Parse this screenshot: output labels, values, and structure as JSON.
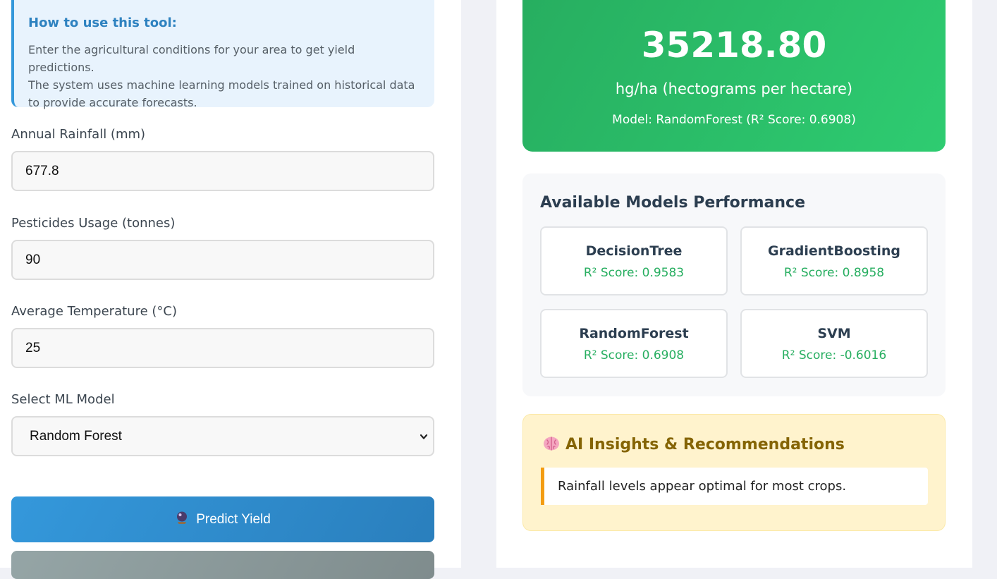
{
  "help": {
    "title": "How to use this tool:",
    "line1": "Enter the agricultural conditions for your area to get yield predictions.",
    "line2": "The system uses machine learning models trained on historical data",
    "line3": "to provide accurate forecasts."
  },
  "form": {
    "rainfall_label": "Annual Rainfall (mm)",
    "rainfall_value": "677.8",
    "pesticides_label": "Pesticides Usage (tonnes)",
    "pesticides_value": "90",
    "temperature_label": "Average Temperature (°C)",
    "temperature_value": "25",
    "model_label": "Select ML Model",
    "model_selected": "Random Forest",
    "predict_button": "Predict Yield",
    "predict_icon": "crystal-ball-icon"
  },
  "result": {
    "value": "35218.80",
    "unit": "hg/ha (hectograms per hectare)",
    "model_info": "Model: RandomForest (R² Score: 0.6908)"
  },
  "models": {
    "title": "Available Models Performance",
    "items": [
      {
        "name": "DecisionTree",
        "score": "R² Score: 0.9583"
      },
      {
        "name": "GradientBoosting",
        "score": "R² Score: 0.8958"
      },
      {
        "name": "RandomForest",
        "score": "R² Score: 0.6908"
      },
      {
        "name": "SVM",
        "score": "R² Score: -0.6016"
      }
    ]
  },
  "insights": {
    "title": "AI Insights & Recommendations",
    "icon": "brain-icon",
    "items": [
      "Rainfall levels appear optimal for most crops."
    ]
  },
  "colors": {
    "accent_blue": "#3498db",
    "success_green": "#27ae60",
    "warning_bg": "#fff3cd",
    "warning_text": "#856404",
    "insight_border": "#f39c12"
  }
}
